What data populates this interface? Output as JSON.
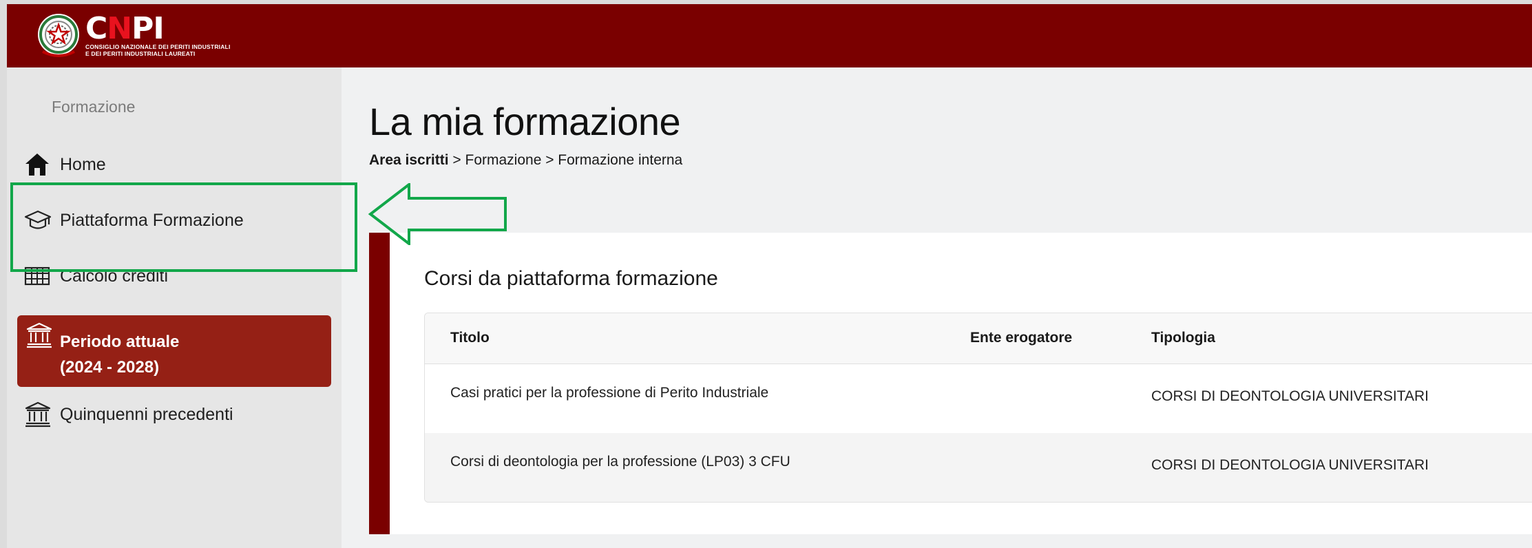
{
  "header": {
    "brand_c": "C",
    "brand_n": "N",
    "brand_pi": "PI",
    "brand_sub1": "CONSIGLIO NAZIONALE DEI PERITI INDUSTRIALI",
    "brand_sub2": "E DEI PERITI INDUSTRIALI LAUREATI",
    "emblem_text": "REPUBBLICA ITALIANA"
  },
  "sidebar": {
    "section_label": "Formazione",
    "items": [
      {
        "label": "Home",
        "icon": "home-icon"
      },
      {
        "label": "Piattaforma Formazione",
        "icon": "graduation-cap-icon"
      },
      {
        "label": "Calcolo crediti",
        "icon": "calculator-icon"
      },
      {
        "label_line1": "Periodo attuale",
        "label_line2": "(2024 - 2028)",
        "icon": "institution-icon",
        "active": true
      },
      {
        "label": "Quinquenni precedenti",
        "icon": "institution-icon"
      }
    ]
  },
  "main": {
    "title": "La mia formazione",
    "breadcrumb": {
      "root": "Area iscritti",
      "rest": " > Formazione > Formazione interna"
    },
    "card": {
      "title": "Corsi da piattaforma formazione",
      "columns": [
        "Titolo",
        "Ente erogatore",
        "Tipologia"
      ],
      "rows": [
        {
          "titolo": "Casi pratici per la professione di Perito Industriale",
          "ente": "",
          "tipologia": "CORSI DI DEONTOLOGIA UNIVERSITARI"
        },
        {
          "titolo": "Corsi di deontologia per la professione (LP03) 3 CFU",
          "ente": "",
          "tipologia": "CORSI DI DEONTOLOGIA UNIVERSITARI"
        }
      ]
    }
  },
  "colors": {
    "header_bg": "#7a0000",
    "active_item_bg": "#952015",
    "annotation_green": "#12a74a",
    "brand_red": "#e8121e"
  }
}
